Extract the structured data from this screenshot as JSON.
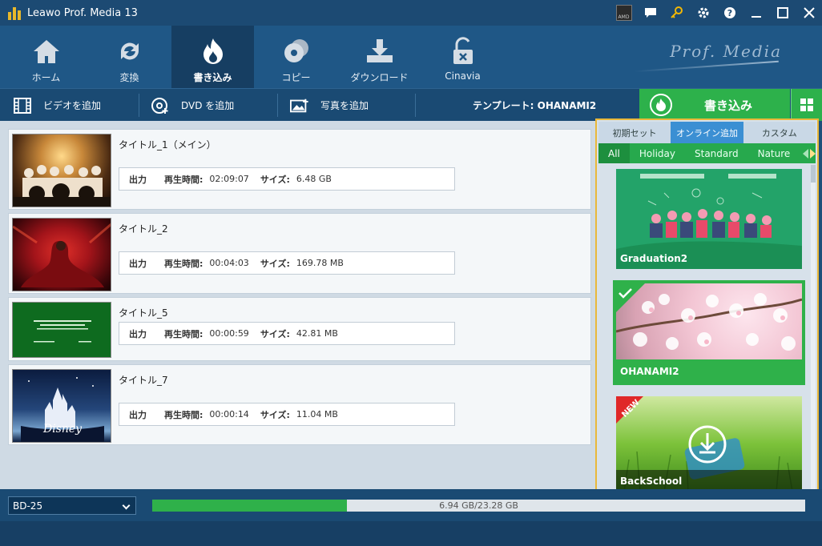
{
  "app": {
    "title": "Leawo Prof. Media 13",
    "brand": "Prof. Media"
  },
  "nav": [
    {
      "label": "ホーム",
      "icon": "home-icon"
    },
    {
      "label": "変換",
      "icon": "convert-icon"
    },
    {
      "label": "書き込み",
      "icon": "burn-icon",
      "active": true
    },
    {
      "label": "コピー",
      "icon": "copy-icon"
    },
    {
      "label": "ダウンロード",
      "icon": "download-icon"
    },
    {
      "label": "Cinavia",
      "icon": "cinavia-lock-icon"
    }
  ],
  "actions": {
    "add_video": "ビデオを追加",
    "add_dvd": "DVD を追加",
    "add_photo": "写真を追加",
    "template": "テンプレート: OHANAMI2",
    "burn": "書き込み"
  },
  "items": [
    {
      "title": "タイトル_1（メイン）",
      "output": "出力",
      "duration_label": "再生時間:",
      "duration": "02:09:07",
      "size_label": "サイズ:",
      "size": "6.48 GB"
    },
    {
      "title": "タイトル_2",
      "output": "出力",
      "duration_label": "再生時間:",
      "duration": "00:04:03",
      "size_label": "サイズ:",
      "size": "169.78 MB"
    },
    {
      "title": "タイトル_5",
      "output": "出力",
      "duration_label": "再生時間:",
      "duration": "00:00:59",
      "size_label": "サイズ:",
      "size": "42.81 MB"
    },
    {
      "title": "タイトル_7",
      "output": "出力",
      "duration_label": "再生時間:",
      "duration": "00:00:14",
      "size_label": "サイズ:",
      "size": "11.04 MB"
    }
  ],
  "panel": {
    "tabs": [
      "初期セット",
      "オンライン追加",
      "カスタム"
    ],
    "active_tab": 1,
    "categories": [
      "All",
      "Holiday",
      "Standard",
      "Nature"
    ],
    "active_category": 0,
    "templates": [
      {
        "name": "Graduation2",
        "selected": false,
        "badge": ""
      },
      {
        "name": "OHANAMI2",
        "selected": true,
        "badge": ""
      },
      {
        "name": "BackSchool",
        "selected": false,
        "badge": "NEW"
      }
    ]
  },
  "bottom": {
    "disc": "BD-25",
    "usage": "6.94 GB/23.28 GB",
    "usage_fraction": 0.298
  },
  "colors": {
    "accent_green": "#2db14b",
    "panel_border": "#e9b83a",
    "tab_active": "#3b8fd3"
  }
}
